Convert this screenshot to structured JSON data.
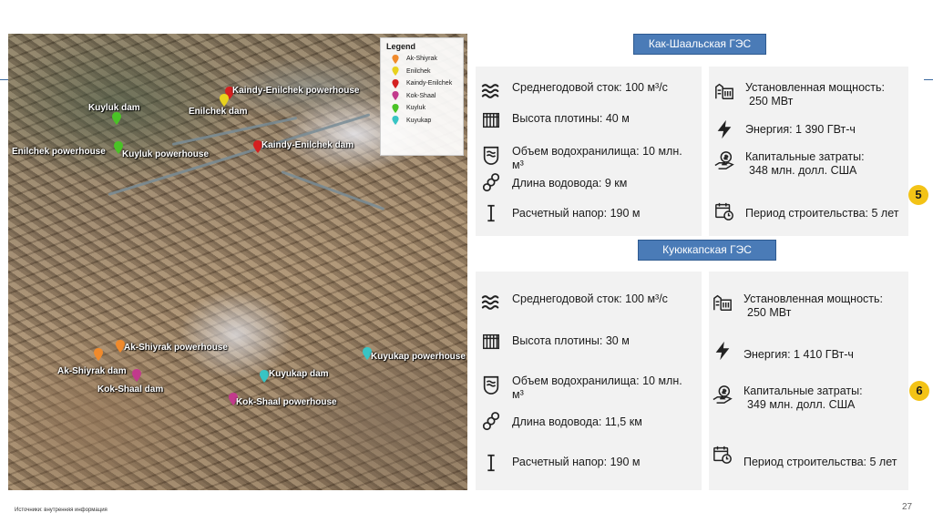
{
  "map": {
    "legend": {
      "title": "Legend",
      "items": [
        {
          "label": "Ak-Shiyrak",
          "color": "#f08a2c"
        },
        {
          "label": "Enilchek",
          "color": "#e8d21e"
        },
        {
          "label": "Kaindy-Enilchek",
          "color": "#d42020"
        },
        {
          "label": "Kok-Shaal",
          "color": "#c23a8c"
        },
        {
          "label": "Kuyluk",
          "color": "#4ac226"
        },
        {
          "label": "Kuyukap",
          "color": "#38c4c4"
        }
      ]
    },
    "labels": {
      "kaindy_powerhouse": "Kaindy-Enilchek powerhouse",
      "enilchek_dam": "Enilchek dam",
      "kuyluk_dam": "Kuyluk dam",
      "enilchek_powerhouse": "Enilchek powerhouse",
      "kuyluk_powerhouse": "Kuyluk powerhouse",
      "kaindy_dam": "Kaindy-Enilchek dam",
      "akshiyrak_powerhouse": "Ak-Shiyrak powerhouse",
      "akshiyrak_dam": "Ak-Shiyrak dam",
      "kokshaal_dam": "Kok-Shaal dam",
      "kuyukap_dam": "Kuyukap dam",
      "kokshaal_powerhouse": "Kok-Shaal powerhouse",
      "kuyukap_powerhouse": "Kuyukap powerhouse"
    }
  },
  "plant1": {
    "title": "Как-Шаальская ГЭС",
    "left": {
      "flow": "Среднегодовой сток: 100 м³/с",
      "dam_height": "Высота плотины: 40 м",
      "reservoir_line1": "Объем водохранилища: 10 млн.",
      "reservoir_line2": "м³",
      "conduit": "Длина водовода: 9 км",
      "head": "Расчетный напор: 190 м"
    },
    "right": {
      "capacity_line1": "Установленная мощность:",
      "capacity_line2": "250 МВт",
      "energy": "Энергия: 1 390 ГВт-ч",
      "capex_line1": "Капитальные затраты:",
      "capex_line2": "348 млн. долл. США",
      "period": "Период строительства: 5 лет"
    },
    "badge": "5"
  },
  "plant2": {
    "title": "Куюккапская ГЭС",
    "left": {
      "flow": "Среднегодовой сток: 100 м³/с",
      "dam_height": "Высота плотины: 30 м",
      "reservoir_line1": "Объем водохранилища: 10 млн.",
      "reservoir_line2": "м³",
      "conduit": "Длина водовода: 11,5 км",
      "head": "Расчетный напор: 190 м"
    },
    "right": {
      "capacity_line1": "Установленная мощность:",
      "capacity_line2": "250 МВт",
      "energy": "Энергия: 1 410 ГВт-ч",
      "capex_line1": "Капитальные затраты:",
      "capex_line2": "349 млн. долл. США",
      "period": "Период строительства: 5 лет"
    },
    "badge": "6"
  },
  "footer": {
    "source": "Источники: внутренняя информация",
    "page_number": "27"
  }
}
